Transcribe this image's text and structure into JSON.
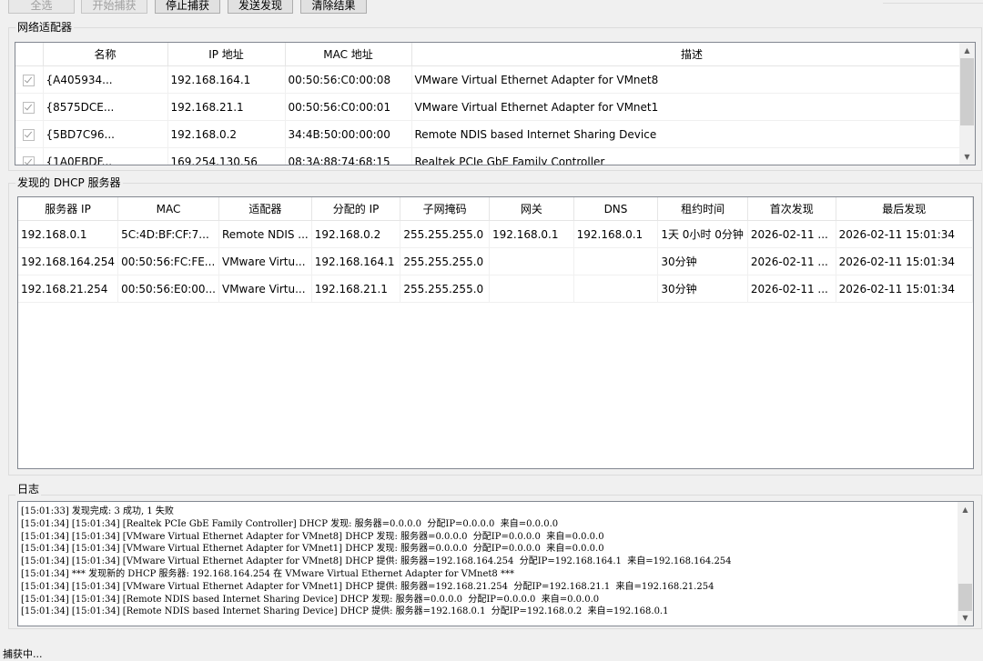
{
  "toolbar": {
    "select_all": "全选",
    "start_capture": "开始捕获",
    "stop_capture": "停止捕获",
    "send_discover": "发送发现",
    "clear_results": "清除结果"
  },
  "adapters": {
    "group_label": "网络适配器",
    "columns": [
      "名称",
      "IP 地址",
      "MAC 地址",
      "描述"
    ],
    "rows": [
      {
        "checked": true,
        "name": "{A405934...",
        "ip": "192.168.164.1",
        "mac": "00:50:56:C0:00:08",
        "desc": "VMware Virtual Ethernet Adapter for VMnet8"
      },
      {
        "checked": true,
        "name": "{8575DCE...",
        "ip": "192.168.21.1",
        "mac": "00:50:56:C0:00:01",
        "desc": "VMware Virtual Ethernet Adapter for VMnet1"
      },
      {
        "checked": true,
        "name": "{5BD7C96...",
        "ip": "192.168.0.2",
        "mac": "34:4B:50:00:00:00",
        "desc": "Remote NDIS based Internet Sharing Device"
      },
      {
        "checked": true,
        "name": "{1A0EBDF...",
        "ip": "169.254.130.56",
        "mac": "08:3A:88:74:68:15",
        "desc": "Realtek PCIe GbE Family Controller"
      }
    ]
  },
  "dhcp": {
    "group_label": "发现的 DHCP 服务器",
    "columns": [
      "服务器 IP",
      "MAC",
      "适配器",
      "分配的 IP",
      "子网掩码",
      "网关",
      "DNS",
      "租约时间",
      "首次发现",
      "最后发现"
    ],
    "rows": [
      [
        "192.168.0.1",
        "5C:4D:BF:CF:7...",
        "Remote NDIS ...",
        "192.168.0.2",
        "255.255.255.0",
        "192.168.0.1",
        "192.168.0.1",
        "1天 0小时 0分钟",
        "2026-02-11 ...",
        "2026-02-11 15:01:34"
      ],
      [
        "192.168.164.254",
        "00:50:56:FC:FE...",
        "VMware Virtu...",
        "192.168.164.1",
        "255.255.255.0",
        "",
        "",
        "30分钟",
        "2026-02-11 ...",
        "2026-02-11 15:01:34"
      ],
      [
        "192.168.21.254",
        "00:50:56:E0:00...",
        "VMware Virtu...",
        "192.168.21.1",
        "255.255.255.0",
        "",
        "",
        "30分钟",
        "2026-02-11 ...",
        "2026-02-11 15:01:34"
      ]
    ]
  },
  "log": {
    "group_label": "日志",
    "lines": [
      "[15:01:33] 发现完成: 3 成功, 1 失败",
      "[15:01:34] [15:01:34] [Realtek PCIe GbE Family Controller] DHCP 发现: 服务器=0.0.0.0  分配IP=0.0.0.0  来自=0.0.0.0",
      "[15:01:34] [15:01:34] [VMware Virtual Ethernet Adapter for VMnet8] DHCP 发现: 服务器=0.0.0.0  分配IP=0.0.0.0  来自=0.0.0.0",
      "[15:01:34] [15:01:34] [VMware Virtual Ethernet Adapter for VMnet1] DHCP 发现: 服务器=0.0.0.0  分配IP=0.0.0.0  来自=0.0.0.0",
      "[15:01:34] [15:01:34] [VMware Virtual Ethernet Adapter for VMnet8] DHCP 提供: 服务器=192.168.164.254  分配IP=192.168.164.1  来自=192.168.164.254",
      "[15:01:34] *** 发现新的 DHCP 服务器: 192.168.164.254 在 VMware Virtual Ethernet Adapter for VMnet8 ***",
      "[15:01:34] [15:01:34] [VMware Virtual Ethernet Adapter for VMnet1] DHCP 提供: 服务器=192.168.21.254  分配IP=192.168.21.1  来自=192.168.21.254",
      "[15:01:34] [15:01:34] [Remote NDIS based Internet Sharing Device] DHCP 发现: 服务器=0.0.0.0  分配IP=0.0.0.0  来自=0.0.0.0",
      "[15:01:34] [15:01:34] [Remote NDIS based Internet Sharing Device] DHCP 提供: 服务器=192.168.0.1  分配IP=192.168.0.2  来自=192.168.0.1"
    ]
  },
  "status": "捕获中...",
  "icons": {
    "scroll_up": "▲",
    "scroll_down": "▼"
  }
}
